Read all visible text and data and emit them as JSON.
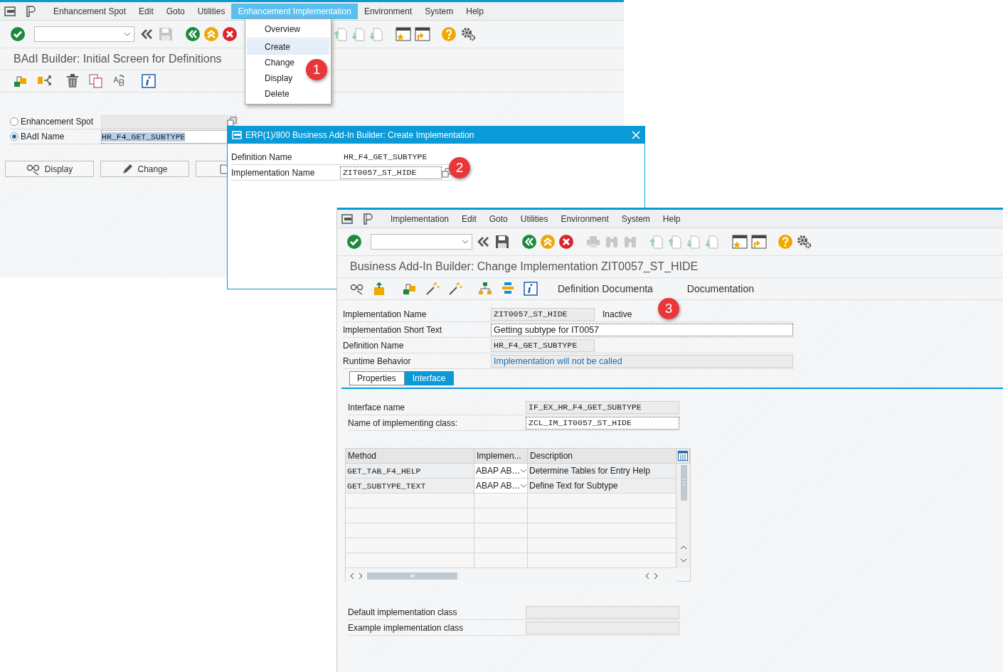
{
  "window_1": {
    "menu_bar": [
      {
        "label": "Enhancement Spot",
        "selected": false
      },
      {
        "label": "Edit",
        "selected": false
      },
      {
        "label": "Goto",
        "selected": false
      },
      {
        "label": "Utilities",
        "selected": false
      },
      {
        "label": "Enhancement Implementation",
        "selected": true
      },
      {
        "label": "Environment",
        "selected": false
      },
      {
        "label": "System",
        "selected": false
      },
      {
        "label": "Help",
        "selected": false
      }
    ],
    "title": "BAdI Builder: Initial Screen for Definitions",
    "options": [
      {
        "label": "Enhancement Spot",
        "selected": false
      },
      {
        "label": "BAdI Name",
        "selected": true,
        "value": "HR_F4_GET_SUBTYPE"
      }
    ],
    "buttons": [
      "Display",
      "Change"
    ]
  },
  "menu": {
    "items": [
      {
        "label": "Overview",
        "selected": false
      },
      {
        "label": "Create",
        "selected": true
      },
      {
        "label": "Change",
        "selected": false
      },
      {
        "label": "Display",
        "selected": false
      },
      {
        "label": "Delete",
        "selected": false
      }
    ]
  },
  "dialog": {
    "title": "ERP(1)/800 Business Add-In Builder: Create Implementation",
    "fields": [
      {
        "label": "Definition Name",
        "value": "HR_F4_GET_SUBTYPE",
        "kind": "text"
      },
      {
        "label": "Implementation Name",
        "value": "ZIT0057_ST_HIDE",
        "kind": "input"
      }
    ]
  },
  "window_3": {
    "menu_bar": [
      {
        "label": "Implementation",
        "selected": false
      },
      {
        "label": "Edit",
        "selected": false
      },
      {
        "label": "Goto",
        "selected": false
      },
      {
        "label": "Utilities",
        "selected": false
      },
      {
        "label": "Environment",
        "selected": false
      },
      {
        "label": "System",
        "selected": false
      },
      {
        "label": "Help",
        "selected": false
      }
    ],
    "title": "Business Add-In Builder: Change Implementation ZIT0057_ST_HIDE",
    "toolbar_buttons": [
      "Definition Documenta",
      "Documentation"
    ],
    "fields": [
      {
        "label": "Implementation Name",
        "value": "ZIT0057_ST_HIDE",
        "kind": "display",
        "status": "Inactive"
      },
      {
        "label": "Implementation Short Text",
        "value": "Getting subtype for IT0057",
        "kind": "text"
      },
      {
        "label": "Definition Name",
        "value": "HR_F4_GET_SUBTYPE",
        "kind": "display"
      },
      {
        "label": "Runtime Behavior",
        "value": "Implementation will not be called",
        "kind": "wide"
      }
    ],
    "tabs": [
      {
        "label": "Properties",
        "selected": false
      },
      {
        "label": "Interface",
        "selected": true
      }
    ],
    "interface_fields": [
      {
        "label": "Interface name",
        "value": "IF_EX_HR_F4_GET_SUBTYPE",
        "kind": "display"
      },
      {
        "label": "Name of implementing class:",
        "value": "ZCL_IM_IT0057_ST_HIDE",
        "kind": "input"
      }
    ],
    "table": {
      "columns": [
        "Method",
        "Implemen...",
        "Description"
      ],
      "rows": [
        {
          "method": "GET_TAB_F4_HELP",
          "implementation": "ABAP AB…",
          "description": "Determine Tables for Entry Help"
        },
        {
          "method": "GET_SUBTYPE_TEXT",
          "implementation": "ABAP AB…",
          "description": "Define Text for Subtype"
        }
      ]
    },
    "class_fields": [
      {
        "label": "Default implementation class"
      },
      {
        "label": "Example implementation class"
      }
    ]
  },
  "callouts": [
    "1",
    "2",
    "3"
  ]
}
